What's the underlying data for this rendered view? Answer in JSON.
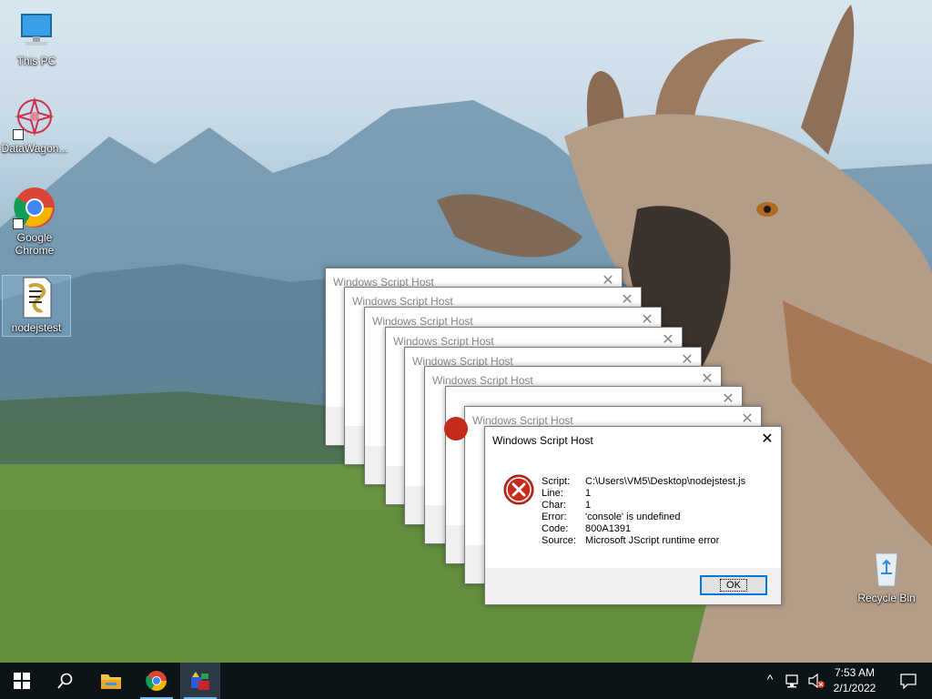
{
  "desktop": {
    "icons": [
      {
        "label": "This PC"
      },
      {
        "label": "DataWagon..."
      },
      {
        "label": "Google Chrome"
      },
      {
        "label": "nodejstest"
      },
      {
        "label": "Recycle Bin"
      }
    ]
  },
  "stacked_dialogs": [
    {
      "title": "Windows Script Host",
      "close": "✕"
    },
    {
      "title": "Windows Script Host",
      "close": "✕"
    },
    {
      "title": "Windows Script Host",
      "close": "✕"
    },
    {
      "title": "Windows Script Host",
      "close": "✕"
    },
    {
      "title": "Windows Script Host",
      "close": "✕"
    },
    {
      "title": "Windows Script Host",
      "close": "✕"
    },
    {
      "title": "",
      "close": "✕"
    },
    {
      "title": "Windows Script Host",
      "close": "✕"
    }
  ],
  "dialog": {
    "title": "Windows Script Host",
    "close": "✕",
    "fields": [
      {
        "label": "Script:",
        "value": "C:\\Users\\VM5\\Desktop\\nodejstest.js"
      },
      {
        "label": "Line:",
        "value": "1"
      },
      {
        "label": "Char:",
        "value": "1"
      },
      {
        "label": "Error:",
        "value": "'console' is undefined"
      },
      {
        "label": "Code:",
        "value": "800A1391"
      },
      {
        "label": "Source:",
        "value": "Microsoft JScript runtime error"
      }
    ],
    "ok_label": "OK"
  },
  "taskbar": {
    "time": "7:53 AM",
    "date": "2/1/2022",
    "chevron": "^"
  },
  "colors": {
    "taskbar": "#0d1418",
    "accent": "#0078d7",
    "error_red": "#c42b1c"
  }
}
